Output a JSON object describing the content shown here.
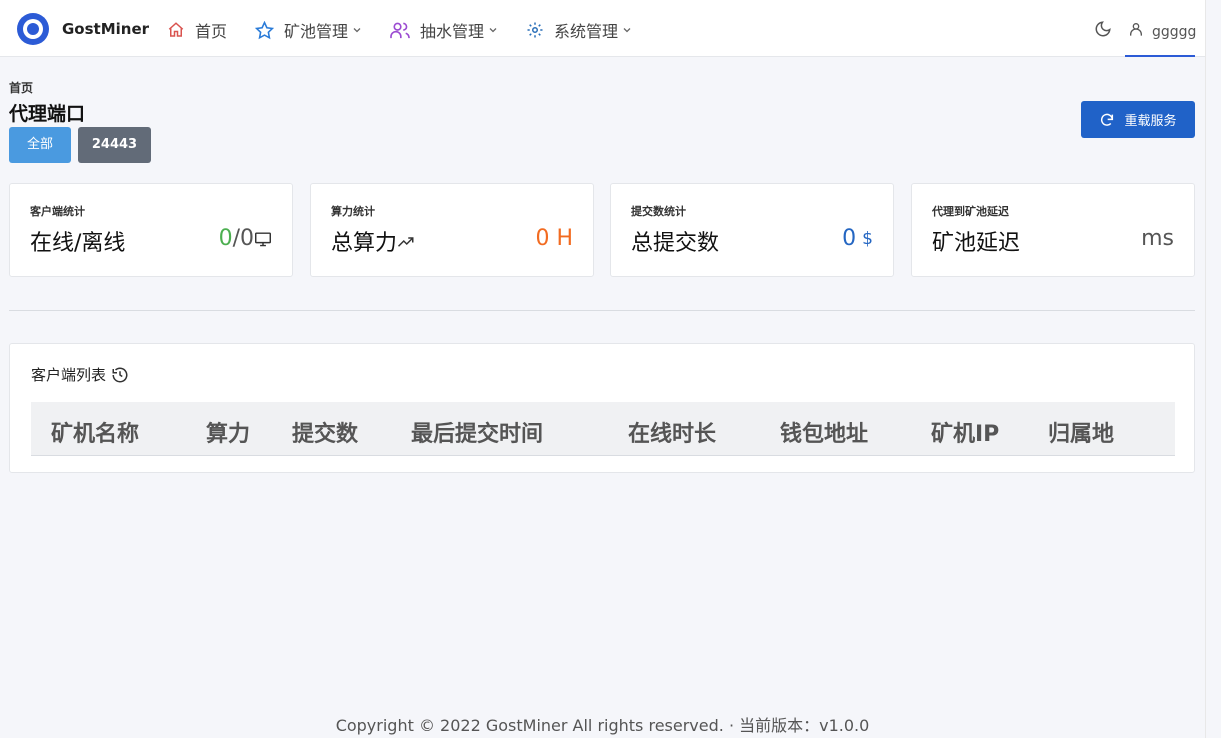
{
  "brand": {
    "name": "GostMiner"
  },
  "nav": {
    "home": "首页",
    "pool": "矿池管理",
    "pump": "抽水管理",
    "system": "系统管理"
  },
  "user": {
    "name": "ggggg"
  },
  "breadcrumb": "首页",
  "page_title": "代理端口",
  "filters": {
    "all": "全部",
    "port": "24443"
  },
  "reload_label": "重载服务",
  "stats": [
    {
      "label": "客户端统计",
      "title": "在线/离线",
      "online": "0",
      "sep": "/",
      "offline": "0",
      "icon": "monitor-icon"
    },
    {
      "label": "算力统计",
      "title": "总算力",
      "value": "0 H",
      "icon": "trending-up-icon"
    },
    {
      "label": "提交数统计",
      "title": "总提交数",
      "value": "0",
      "unit": "$",
      "icon": "dollar-icon"
    },
    {
      "label": "代理到矿池延迟",
      "title": "矿池延迟",
      "value": "ms"
    }
  ],
  "client_list": {
    "title": "客户端列表",
    "columns": [
      "矿机名称",
      "算力",
      "提交数",
      "最后提交时间",
      "在线时长",
      "钱包地址",
      "矿机IP",
      "归属地"
    ]
  },
  "footer": "Copyright © 2022 GostMiner All rights reserved.  ·  当前版本：v1.0.0",
  "colors": {
    "accent": "#2062c8",
    "online": "#4caf50",
    "hashrate": "#f26b21",
    "shares": "#2466c2"
  }
}
